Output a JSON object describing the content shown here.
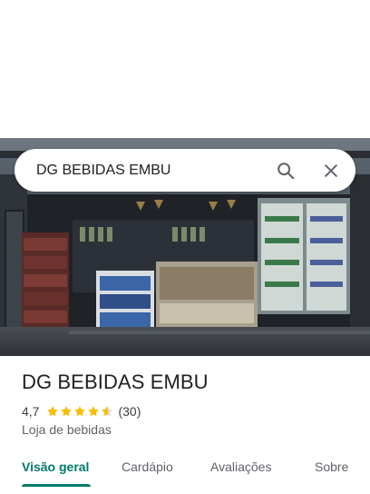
{
  "search": {
    "value": "DG BEBIDAS EMBU"
  },
  "icons": {
    "search": "search-icon",
    "close": "close-icon",
    "star": "star-icon"
  },
  "place": {
    "name": "DG BEBIDAS EMBU",
    "rating": "4,7",
    "rating_value": 4.7,
    "reviews": "(30)",
    "category": "Loja de bebidas"
  },
  "tabs": [
    {
      "label": "Visão geral",
      "active": true
    },
    {
      "label": "Cardápio",
      "active": false
    },
    {
      "label": "Avaliações",
      "active": false
    },
    {
      "label": "Sobre",
      "active": false
    }
  ],
  "colors": {
    "accent": "#00796b",
    "star": "#fbbc04",
    "text": "#202124",
    "muted": "#5f6368"
  }
}
